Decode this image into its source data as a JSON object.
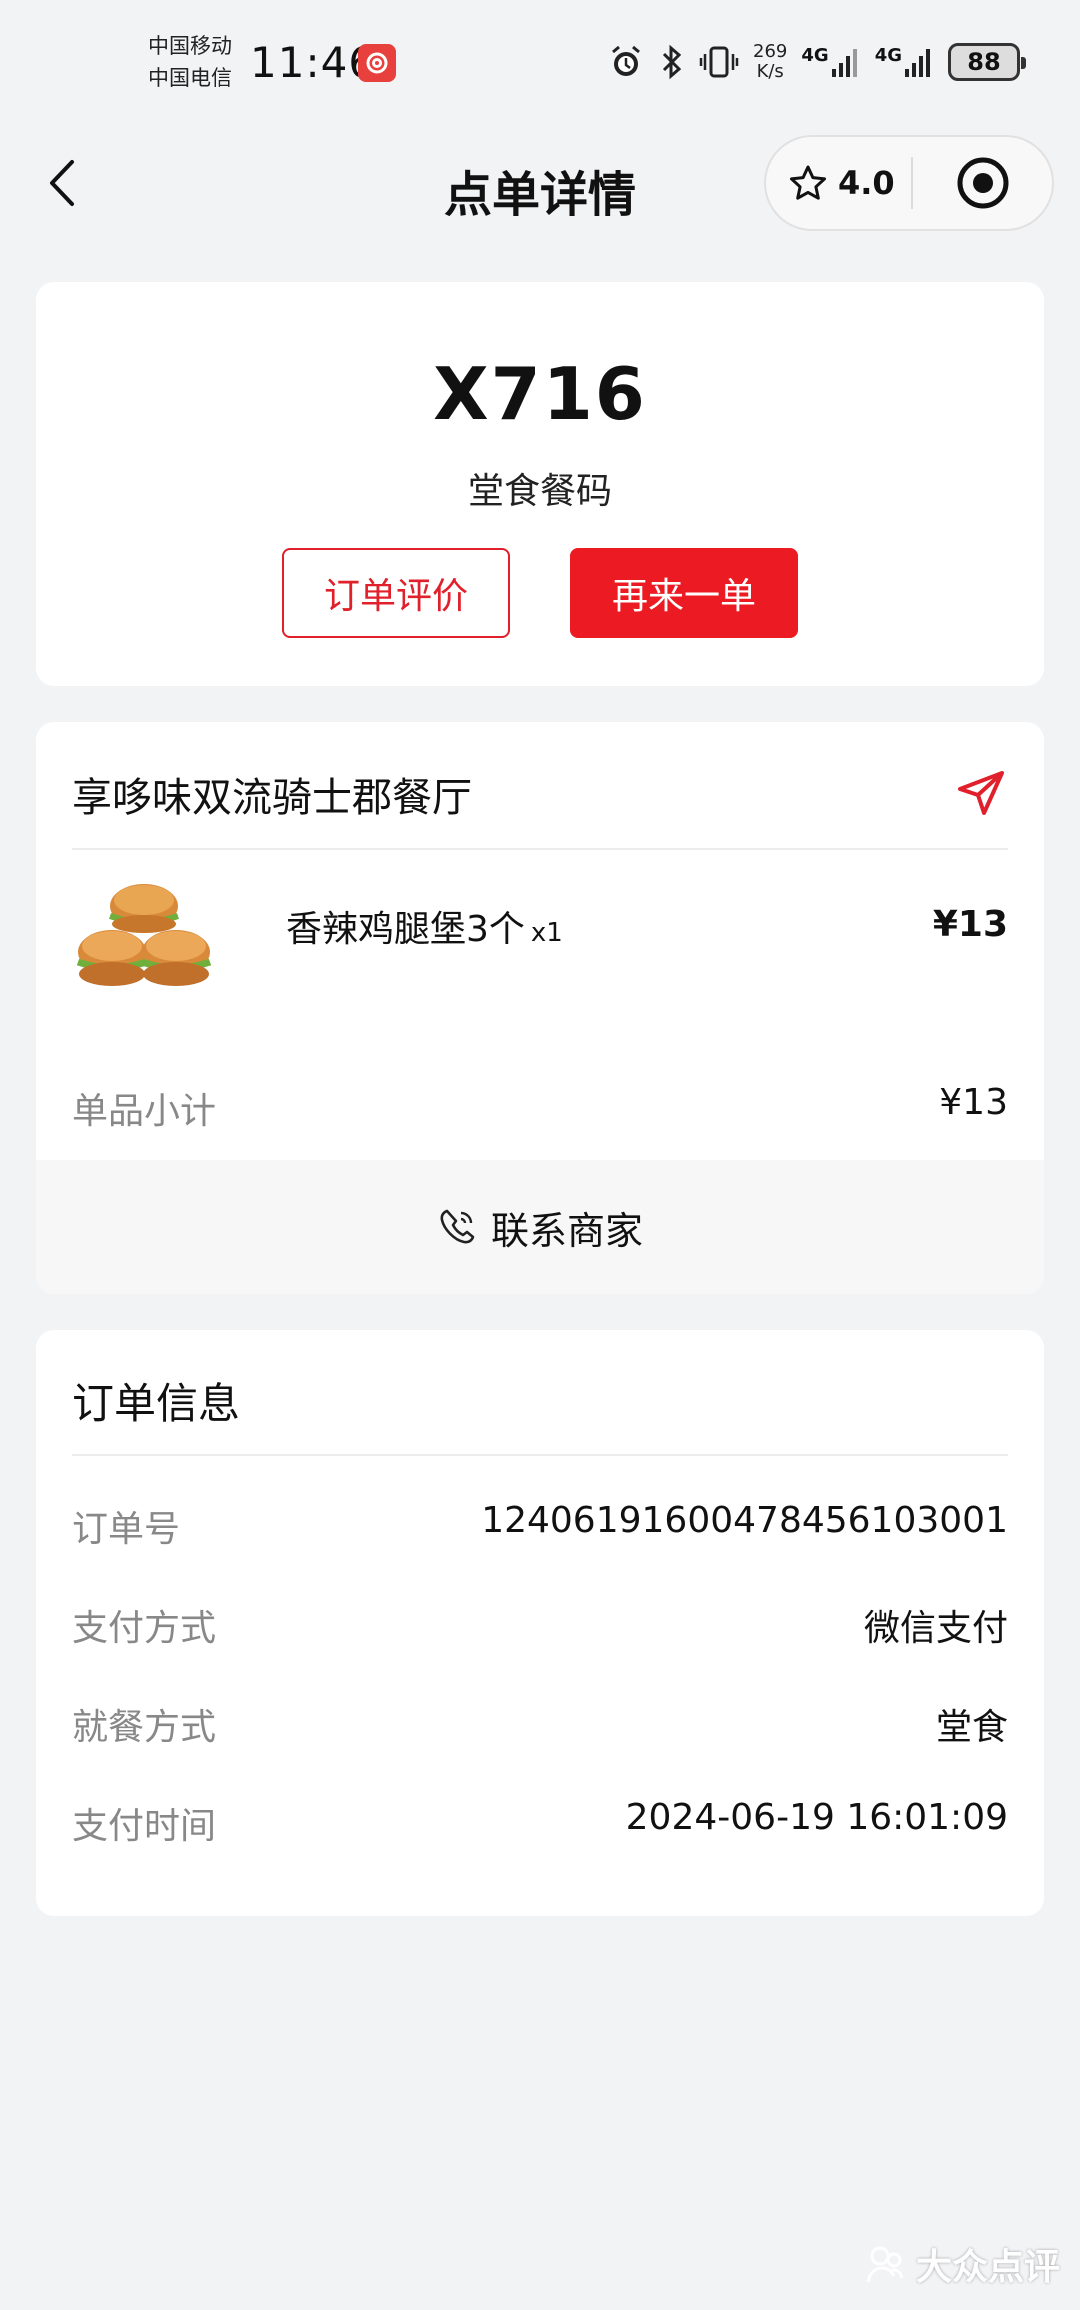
{
  "status_bar": {
    "carrier1": "中国移动",
    "carrier2": "中国电信",
    "time": "11:46",
    "net_speed_value": "269",
    "net_speed_unit": "K/s",
    "network1": "4G",
    "network2": "4G",
    "battery": "88"
  },
  "nav": {
    "title": "点单详情",
    "rating": "4.0"
  },
  "pickup": {
    "code": "X716",
    "label": "堂食餐码",
    "review_button": "订单评价",
    "reorder_button": "再来一单"
  },
  "order": {
    "shop_name": "享哆味双流骑士郡餐厅",
    "item": {
      "name": "香辣鸡腿堡3个",
      "qty": "x1",
      "price": "¥13"
    },
    "subtotal_label": "单品小计",
    "subtotal_value": "¥13",
    "contact_label": "联系商家"
  },
  "info": {
    "title": "订单信息",
    "rows": [
      {
        "label": "订单号",
        "value": "1240619160047845610300​1"
      },
      {
        "label": "支付方式",
        "value": "微信支付"
      },
      {
        "label": "就餐方式",
        "value": "堂食"
      },
      {
        "label": "支付时间",
        "value": "2024-06-19 16:01:09"
      }
    ]
  },
  "watermark": "大众点评",
  "colors": {
    "accent": "#ec1b23",
    "background": "#f2f3f5"
  }
}
